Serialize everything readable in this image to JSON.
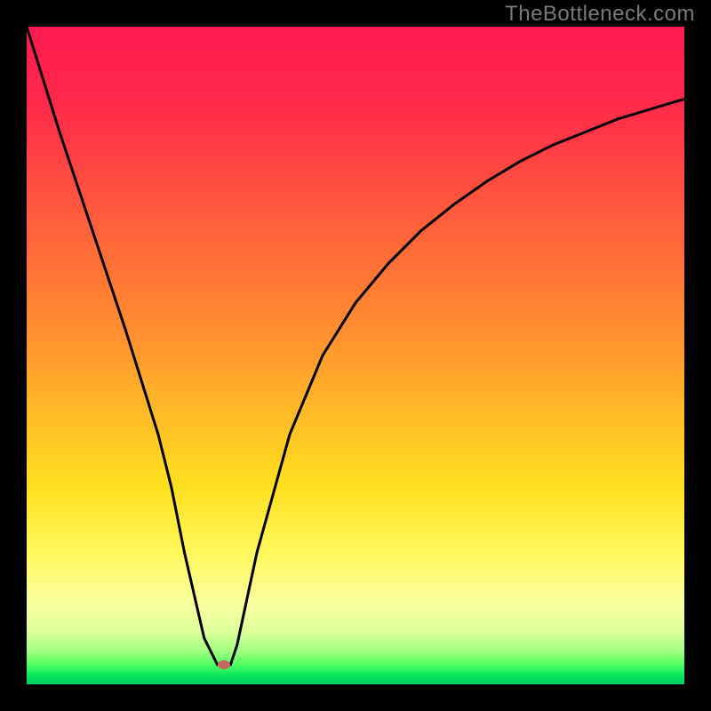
{
  "watermark": "TheBottleneck.com",
  "chart_data": {
    "type": "line",
    "title": "",
    "xlabel": "",
    "ylabel": "",
    "xlim": [
      0,
      100
    ],
    "ylim": [
      0,
      100
    ],
    "grid": false,
    "series": [
      {
        "name": "curve",
        "x": [
          0,
          5,
          10,
          15,
          20,
          22,
          24,
          27,
          29,
          30,
          31,
          32,
          35,
          40,
          45,
          50,
          55,
          60,
          65,
          70,
          75,
          80,
          85,
          90,
          95,
          100
        ],
        "values": [
          100,
          84,
          69,
          54,
          38,
          30,
          20,
          7,
          3,
          3,
          3,
          6,
          20,
          38,
          50,
          58,
          64,
          69,
          73,
          76.5,
          79.5,
          82,
          84,
          86,
          87.5,
          89
        ]
      }
    ],
    "marker": {
      "x": 30,
      "y": 3
    },
    "background": {
      "type": "vertical-gradient",
      "stops": [
        {
          "pos": 0,
          "color": "#ff1a4f"
        },
        {
          "pos": 0.45,
          "color": "#ff8a30"
        },
        {
          "pos": 0.7,
          "color": "#ffe020"
        },
        {
          "pos": 0.88,
          "color": "#faffa0"
        },
        {
          "pos": 0.97,
          "color": "#50ff60"
        },
        {
          "pos": 1.0,
          "color": "#00d060"
        }
      ]
    }
  }
}
